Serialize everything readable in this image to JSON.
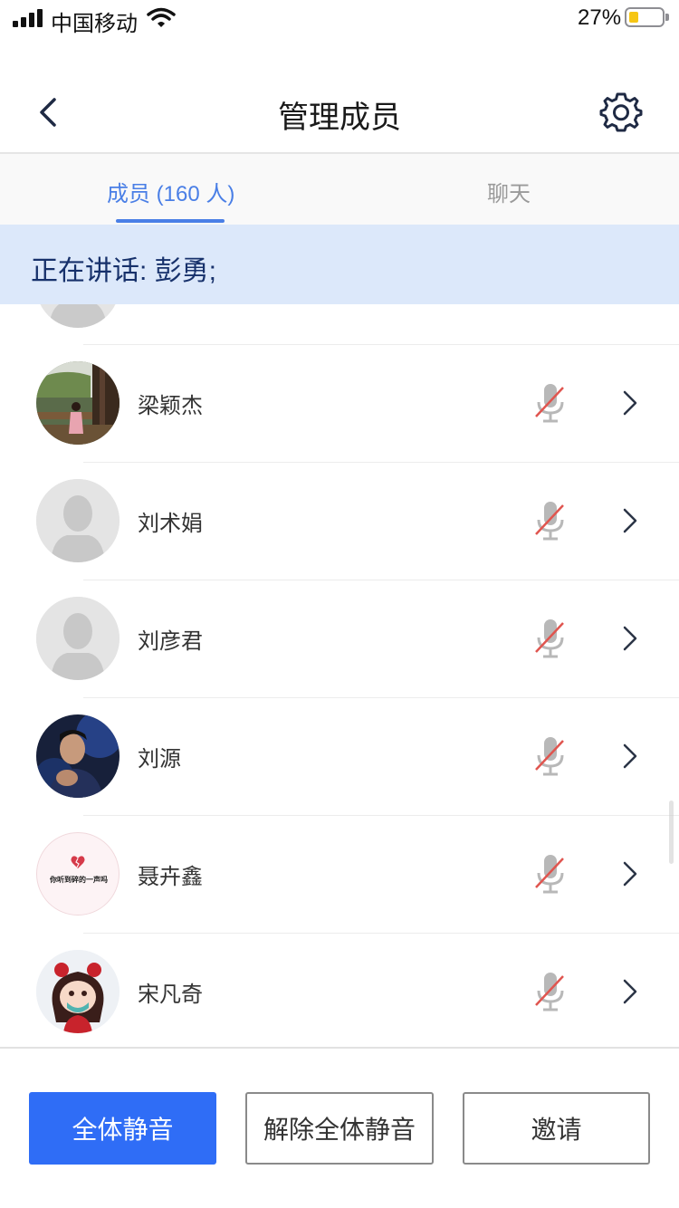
{
  "status_bar": {
    "carrier": "中国移动",
    "battery_percent": "27%",
    "battery_level": 0.27,
    "battery_color": "#f6c614"
  },
  "nav": {
    "title": "管理成员",
    "back_icon": "chevron-left-icon",
    "settings_icon": "gear-icon"
  },
  "tabs": [
    {
      "label": "成员 (160 人)",
      "active": true
    },
    {
      "label": "聊天",
      "active": false
    }
  ],
  "speaking_banner": "正在讲话: 彭勇;",
  "members": [
    {
      "name": "梁颖杰",
      "avatar": "photo",
      "muted": true
    },
    {
      "name": "刘术娟",
      "avatar": "default-silhouette",
      "muted": true
    },
    {
      "name": "刘彦君",
      "avatar": "default-silhouette",
      "muted": true
    },
    {
      "name": "刘源",
      "avatar": "photo",
      "muted": true
    },
    {
      "name": "聂卉鑫",
      "avatar": "text-image",
      "avatar_text": "你听到碎的一声吗",
      "muted": true
    },
    {
      "name": "宋凡奇",
      "avatar": "cartoon",
      "muted": true
    }
  ],
  "actions": {
    "mute_all": "全体静音",
    "unmute_all": "解除全体静音",
    "invite": "邀请"
  },
  "colors": {
    "accent": "#2f6df6",
    "tab_active": "#4a7fe6",
    "banner_bg": "#dce8fa",
    "banner_text": "#17316b",
    "mute_slash": "#e0554f"
  }
}
